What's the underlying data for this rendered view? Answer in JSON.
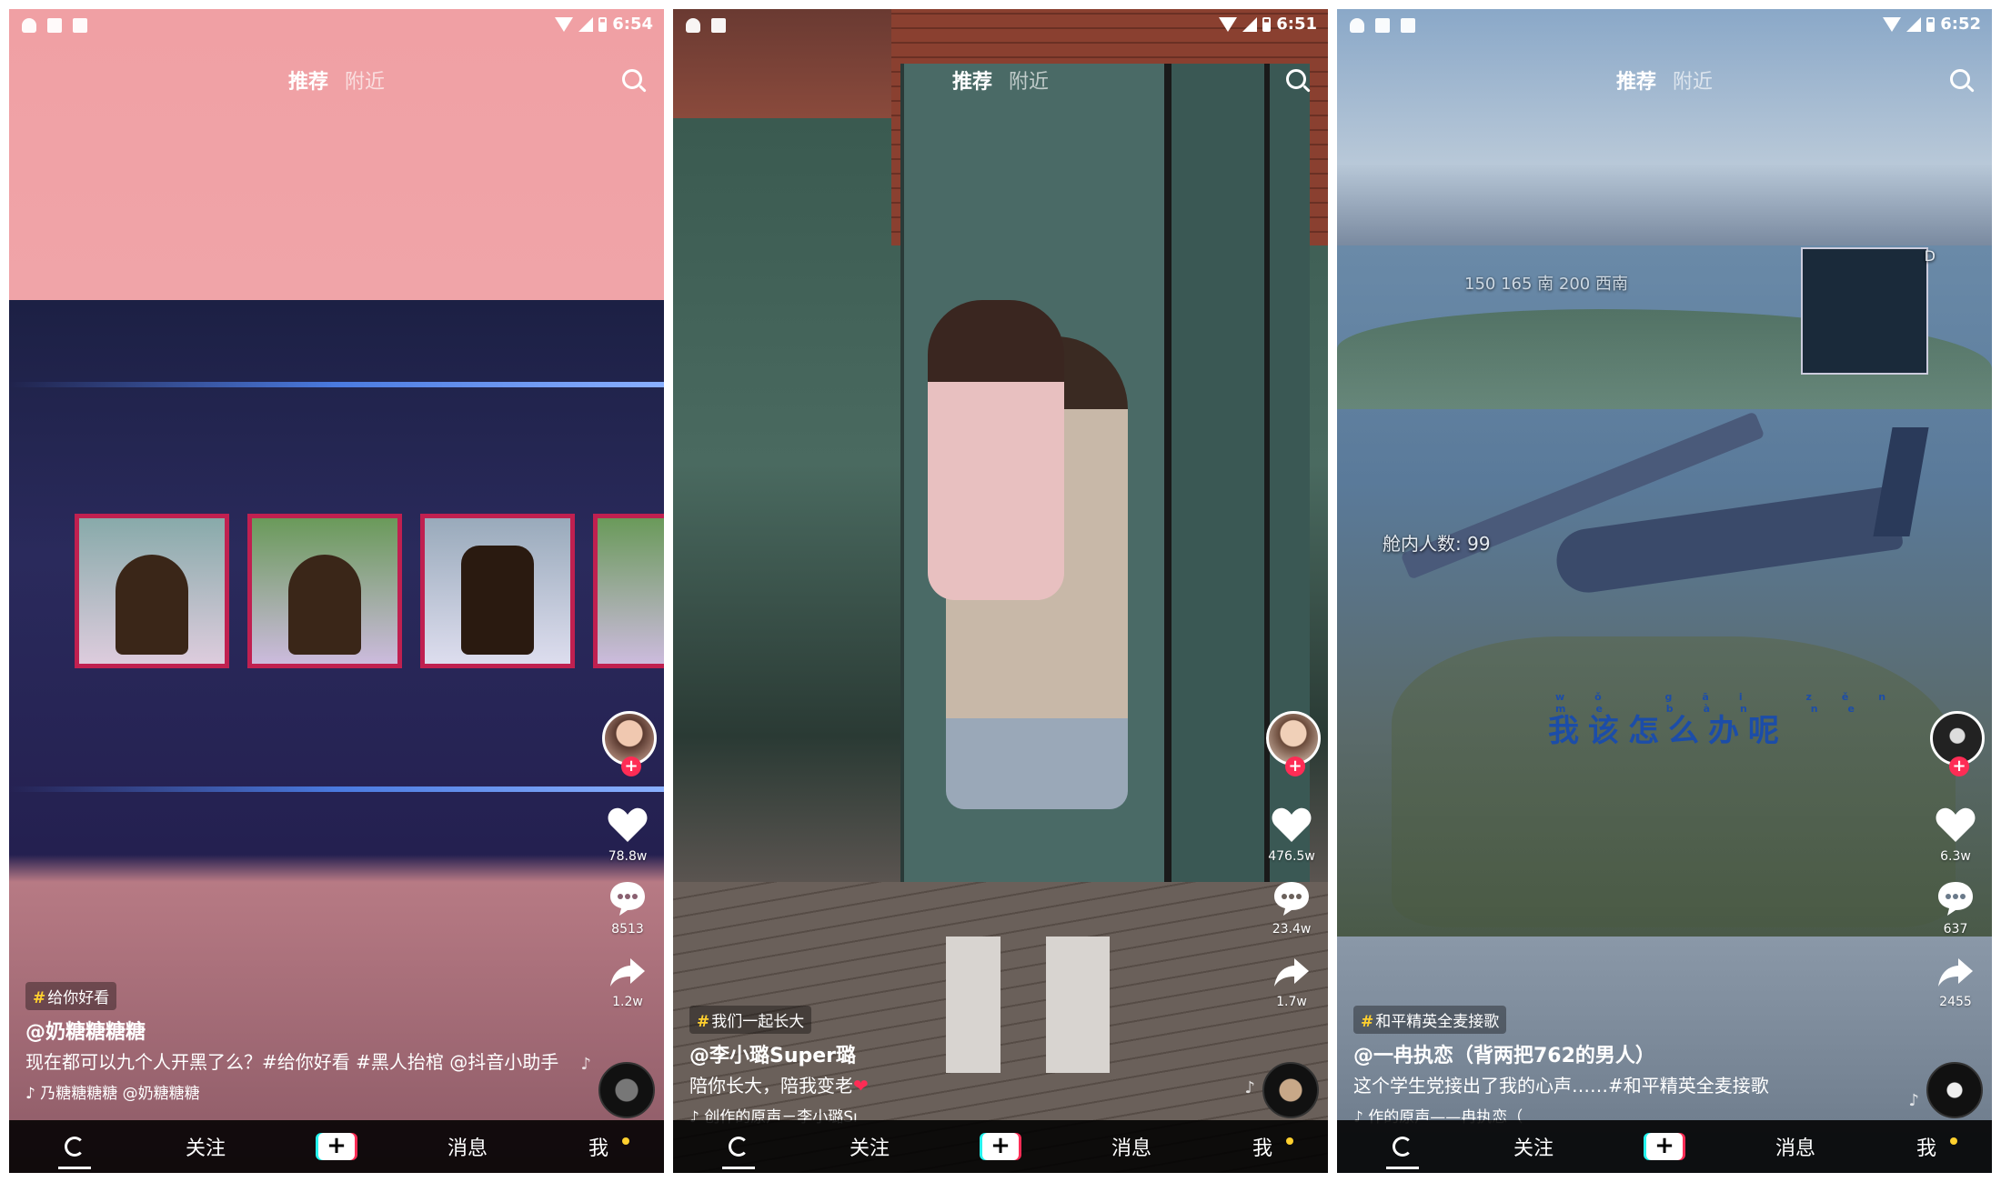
{
  "nav": {
    "tab_recommend": "推荐",
    "tab_nearby": "附近"
  },
  "bottom_nav": {
    "follow": "关注",
    "create": "+",
    "messages": "消息",
    "me": "我"
  },
  "accent": {
    "brand_red": "#fe2c55",
    "brand_cyan": "#25f4ee",
    "tag_yellow": "#ffd02e"
  },
  "icons": [
    "android-icon",
    "image-icon",
    "notification-icon",
    "wifi-icon",
    "signal-icon",
    "battery-icon",
    "search-icon",
    "heart-icon",
    "comment-icon",
    "share-icon",
    "music-disc-icon",
    "refresh-icon",
    "plus-icon"
  ],
  "phones": [
    {
      "time": "6:54",
      "likes": "78.8w",
      "comments": "8513",
      "shares": "1.2w",
      "tag": "给你好看",
      "author": "@奶糖糖糖糖",
      "desc": "现在都可以九个人开黑了么？#给你好看 #黑人抬棺 @抖音小助手",
      "music": "♪ 乃糖糖糖糖    @奶糖糖糖"
    },
    {
      "time": "6:51",
      "likes": "476.5w",
      "comments": "23.4w",
      "shares": "1.7w",
      "tag": "我们一起长大",
      "author": "@李小璐Super璐",
      "desc": "陪你长大，陪我变老",
      "desc_heart": "❤",
      "music": "♪ 创作的原声－李小璐Sı"
    },
    {
      "time": "6:52",
      "likes": "6.3w",
      "comments": "637",
      "shares": "2455",
      "tag": "和平精英全麦接歌",
      "author": "@一冉执恋（背两把762的男人）",
      "desc": "这个学生党接出了我的心声……#和平精英全麦接歌",
      "music": "♪ 作的原声——冉执恋（",
      "game_lyrics": "我该怎么办呢",
      "game_pinyin": "wǒ gāi zěn me bàn ne",
      "game_hud_passengers": "舱内人数: 99",
      "game_hud_compass": "150   165   南   200   西南",
      "game_hud_marker": "D"
    }
  ]
}
